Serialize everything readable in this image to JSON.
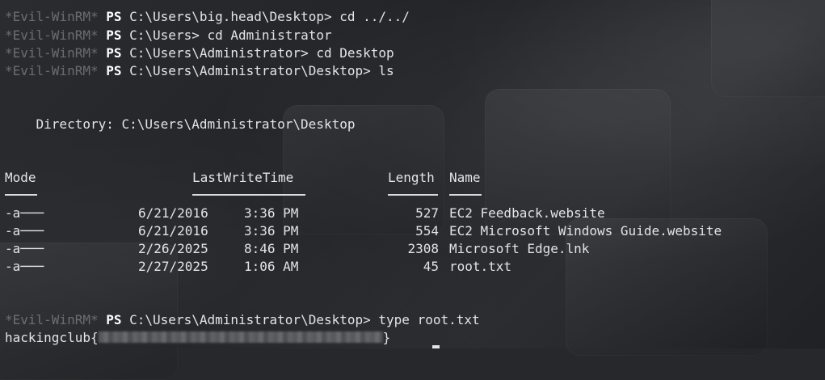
{
  "prompt_tag": "*Evil-WinRM*",
  "ps": "PS",
  "history": [
    {
      "path": "C:\\Users\\big.head\\Desktop>",
      "cmd": " cd ../../"
    },
    {
      "path": "C:\\Users>",
      "cmd": " cd Administrator"
    },
    {
      "path": "C:\\Users\\Administrator>",
      "cmd": " cd Desktop"
    },
    {
      "path": "C:\\Users\\Administrator\\Desktop>",
      "cmd": " ls"
    }
  ],
  "directory_line": "    Directory: C:\\Users\\Administrator\\Desktop",
  "headers": {
    "mode": "Mode",
    "lastwritetime": "LastWriteTime",
    "length": "Length",
    "name": "Name"
  },
  "rows": [
    {
      "mode": "-a───",
      "date": "6/21/2016",
      "time": "3:36 PM",
      "length": "527",
      "name": "EC2 Feedback.website"
    },
    {
      "mode": "-a───",
      "date": "6/21/2016",
      "time": "3:36 PM",
      "length": "554",
      "name": "EC2 Microsoft Windows Guide.website"
    },
    {
      "mode": "-a───",
      "date": "2/26/2025",
      "time": "8:46 PM",
      "length": "2308",
      "name": "Microsoft Edge.lnk"
    },
    {
      "mode": "-a───",
      "date": "2/27/2025",
      "time": "1:06 AM",
      "length": "45",
      "name": "root.txt"
    }
  ],
  "final": {
    "path": "C:\\Users\\Administrator\\Desktop>",
    "cmd": " type root.txt"
  },
  "flag": {
    "prefix": "hackingclub{",
    "suffix": "}"
  }
}
